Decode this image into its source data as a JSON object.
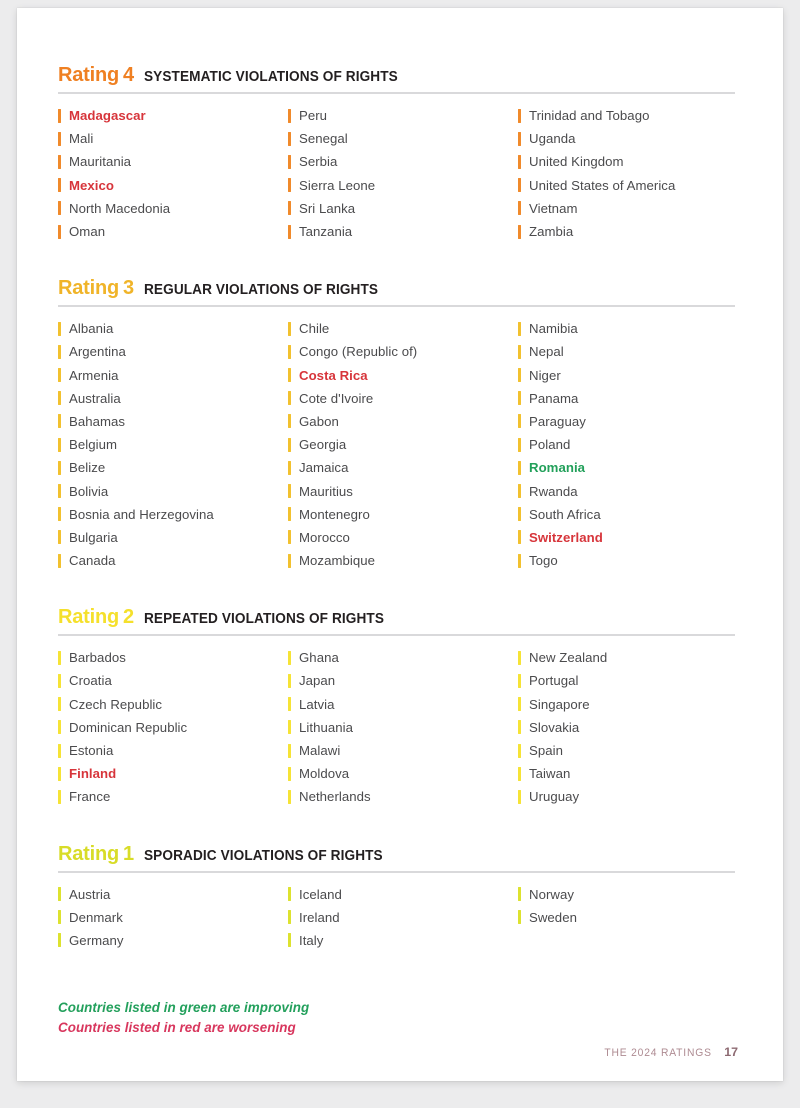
{
  "document": {
    "footer_label": "THE 2024 RATINGS",
    "page_number": "17"
  },
  "legend": {
    "improving": "Countries listed in green are improving",
    "worsening": "Countries listed in red are worsening",
    "improving_color": "#23a05c",
    "worsening_color": "#d8365d"
  },
  "sections": [
    {
      "rating_word": "Rating",
      "rating_number": "4",
      "title": "SYSTEMATIC VIOLATIONS OF RIGHTS",
      "accent_color": "#ef8022",
      "bar_color": "#f08a2b",
      "countries": [
        {
          "name": "Madagascar",
          "status": "worsening"
        },
        {
          "name": "Mali",
          "status": "none"
        },
        {
          "name": "Mauritania",
          "status": "none"
        },
        {
          "name": "Mexico",
          "status": "worsening"
        },
        {
          "name": "North Macedonia",
          "status": "none"
        },
        {
          "name": "Oman",
          "status": "none"
        },
        {
          "name": "Peru",
          "status": "none"
        },
        {
          "name": "Senegal",
          "status": "none"
        },
        {
          "name": "Serbia",
          "status": "none"
        },
        {
          "name": "Sierra Leone",
          "status": "none"
        },
        {
          "name": "Sri Lanka",
          "status": "none"
        },
        {
          "name": "Tanzania",
          "status": "none"
        },
        {
          "name": "Trinidad and Tobago",
          "status": "none"
        },
        {
          "name": "Uganda",
          "status": "none"
        },
        {
          "name": "United Kingdom",
          "status": "none"
        },
        {
          "name": "United States of America",
          "status": "none"
        },
        {
          "name": "Vietnam",
          "status": "none"
        },
        {
          "name": "Zambia",
          "status": "none"
        }
      ]
    },
    {
      "rating_word": "Rating",
      "rating_number": "3",
      "title": "REGULAR VIOLATIONS OF RIGHTS",
      "accent_color": "#f0b429",
      "bar_color": "#f2c12f",
      "countries": [
        {
          "name": "Albania",
          "status": "none"
        },
        {
          "name": "Argentina",
          "status": "none"
        },
        {
          "name": "Armenia",
          "status": "none"
        },
        {
          "name": "Australia",
          "status": "none"
        },
        {
          "name": "Bahamas",
          "status": "none"
        },
        {
          "name": "Belgium",
          "status": "none"
        },
        {
          "name": "Belize",
          "status": "none"
        },
        {
          "name": "Bolivia",
          "status": "none"
        },
        {
          "name": "Bosnia and Herzegovina",
          "status": "none"
        },
        {
          "name": "Bulgaria",
          "status": "none"
        },
        {
          "name": "Canada",
          "status": "none"
        },
        {
          "name": "Chile",
          "status": "none"
        },
        {
          "name": "Congo (Republic of)",
          "status": "none"
        },
        {
          "name": "Costa Rica",
          "status": "worsening"
        },
        {
          "name": "Cote d'Ivoire",
          "status": "none"
        },
        {
          "name": "Gabon",
          "status": "none"
        },
        {
          "name": "Georgia",
          "status": "none"
        },
        {
          "name": "Jamaica",
          "status": "none"
        },
        {
          "name": "Mauritius",
          "status": "none"
        },
        {
          "name": "Montenegro",
          "status": "none"
        },
        {
          "name": "Morocco",
          "status": "none"
        },
        {
          "name": "Mozambique",
          "status": "none"
        },
        {
          "name": "Namibia",
          "status": "none"
        },
        {
          "name": "Nepal",
          "status": "none"
        },
        {
          "name": "Niger",
          "status": "none"
        },
        {
          "name": "Panama",
          "status": "none"
        },
        {
          "name": "Paraguay",
          "status": "none"
        },
        {
          "name": "Poland",
          "status": "none"
        },
        {
          "name": "Romania",
          "status": "improving"
        },
        {
          "name": "Rwanda",
          "status": "none"
        },
        {
          "name": "South Africa",
          "status": "none"
        },
        {
          "name": "Switzerland",
          "status": "worsening"
        },
        {
          "name": "Togo",
          "status": "none"
        }
      ]
    },
    {
      "rating_word": "Rating",
      "rating_number": "2",
      "title": "REPEATED VIOLATIONS OF RIGHTS",
      "accent_color": "#f5e02c",
      "bar_color": "#f6e336",
      "countries": [
        {
          "name": "Barbados",
          "status": "none"
        },
        {
          "name": "Croatia",
          "status": "none"
        },
        {
          "name": "Czech Republic",
          "status": "none"
        },
        {
          "name": "Dominican Republic",
          "status": "none"
        },
        {
          "name": "Estonia",
          "status": "none"
        },
        {
          "name": "Finland",
          "status": "worsening"
        },
        {
          "name": "France",
          "status": "none"
        },
        {
          "name": "Ghana",
          "status": "none"
        },
        {
          "name": "Japan",
          "status": "none"
        },
        {
          "name": "Latvia",
          "status": "none"
        },
        {
          "name": "Lithuania",
          "status": "none"
        },
        {
          "name": "Malawi",
          "status": "none"
        },
        {
          "name": "Moldova",
          "status": "none"
        },
        {
          "name": "Netherlands",
          "status": "none"
        },
        {
          "name": "New Zealand",
          "status": "none"
        },
        {
          "name": "Portugal",
          "status": "none"
        },
        {
          "name": "Singapore",
          "status": "none"
        },
        {
          "name": "Slovakia",
          "status": "none"
        },
        {
          "name": "Spain",
          "status": "none"
        },
        {
          "name": "Taiwan",
          "status": "none"
        },
        {
          "name": "Uruguay",
          "status": "none"
        }
      ]
    },
    {
      "rating_word": "Rating",
      "rating_number": "1",
      "title": "SPORADIC VIOLATIONS OF RIGHTS",
      "accent_color": "#d8dc28",
      "bar_color": "#dde22f",
      "countries": [
        {
          "name": "Austria",
          "status": "none"
        },
        {
          "name": "Denmark",
          "status": "none"
        },
        {
          "name": "Germany",
          "status": "none"
        },
        {
          "name": "Iceland",
          "status": "none"
        },
        {
          "name": "Ireland",
          "status": "none"
        },
        {
          "name": "Italy",
          "status": "none"
        },
        {
          "name": "Norway",
          "status": "none"
        },
        {
          "name": "Sweden",
          "status": "none"
        }
      ]
    }
  ]
}
